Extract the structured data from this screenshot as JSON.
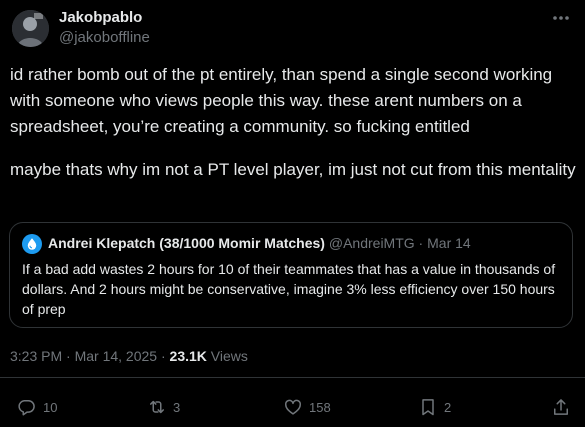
{
  "author": {
    "display_name": "Jakobpablo",
    "handle": "@jakoboffline"
  },
  "tweet": {
    "paragraphs": [
      "id rather bomb out of the pt entirely, than spend a single second working with someone who views people this way. these arent numbers on a spreadsheet, you’re creating a community. so fucking entitled",
      "maybe thats why im not a PT level player, im just not cut from this mentality"
    ],
    "timestamp": "3:23 PM · Mar 14, 2025",
    "separator": " · ",
    "views_count": "23.1K",
    "views_label": "Views"
  },
  "quote": {
    "display_name": "Andrei Klepatch (38/1000 Momir Matches)",
    "handle": "@AndreiMTG",
    "meta_sep": " · ",
    "date": "Mar 14",
    "text": "If a bad add wastes 2 hours for 10 of their teammates that has a value in thousands of dollars. And 2 hours might be conservative, imagine 3% less efficiency over 150 hours of prep"
  },
  "actions": {
    "replies": "10",
    "reposts": "3",
    "likes": "158",
    "bookmarks": "2"
  },
  "icons": {
    "more": "more-icon",
    "reply": "reply-icon",
    "repost": "repost-icon",
    "like": "heart-icon",
    "bookmark": "bookmark-icon",
    "share": "share-icon",
    "quote_avatar": "mtg-blue-mana-icon"
  },
  "colors": {
    "background": "#000000",
    "text": "#e7e9ea",
    "muted": "#71767b",
    "border": "#2f3336",
    "accent": "#1d9bf0"
  }
}
